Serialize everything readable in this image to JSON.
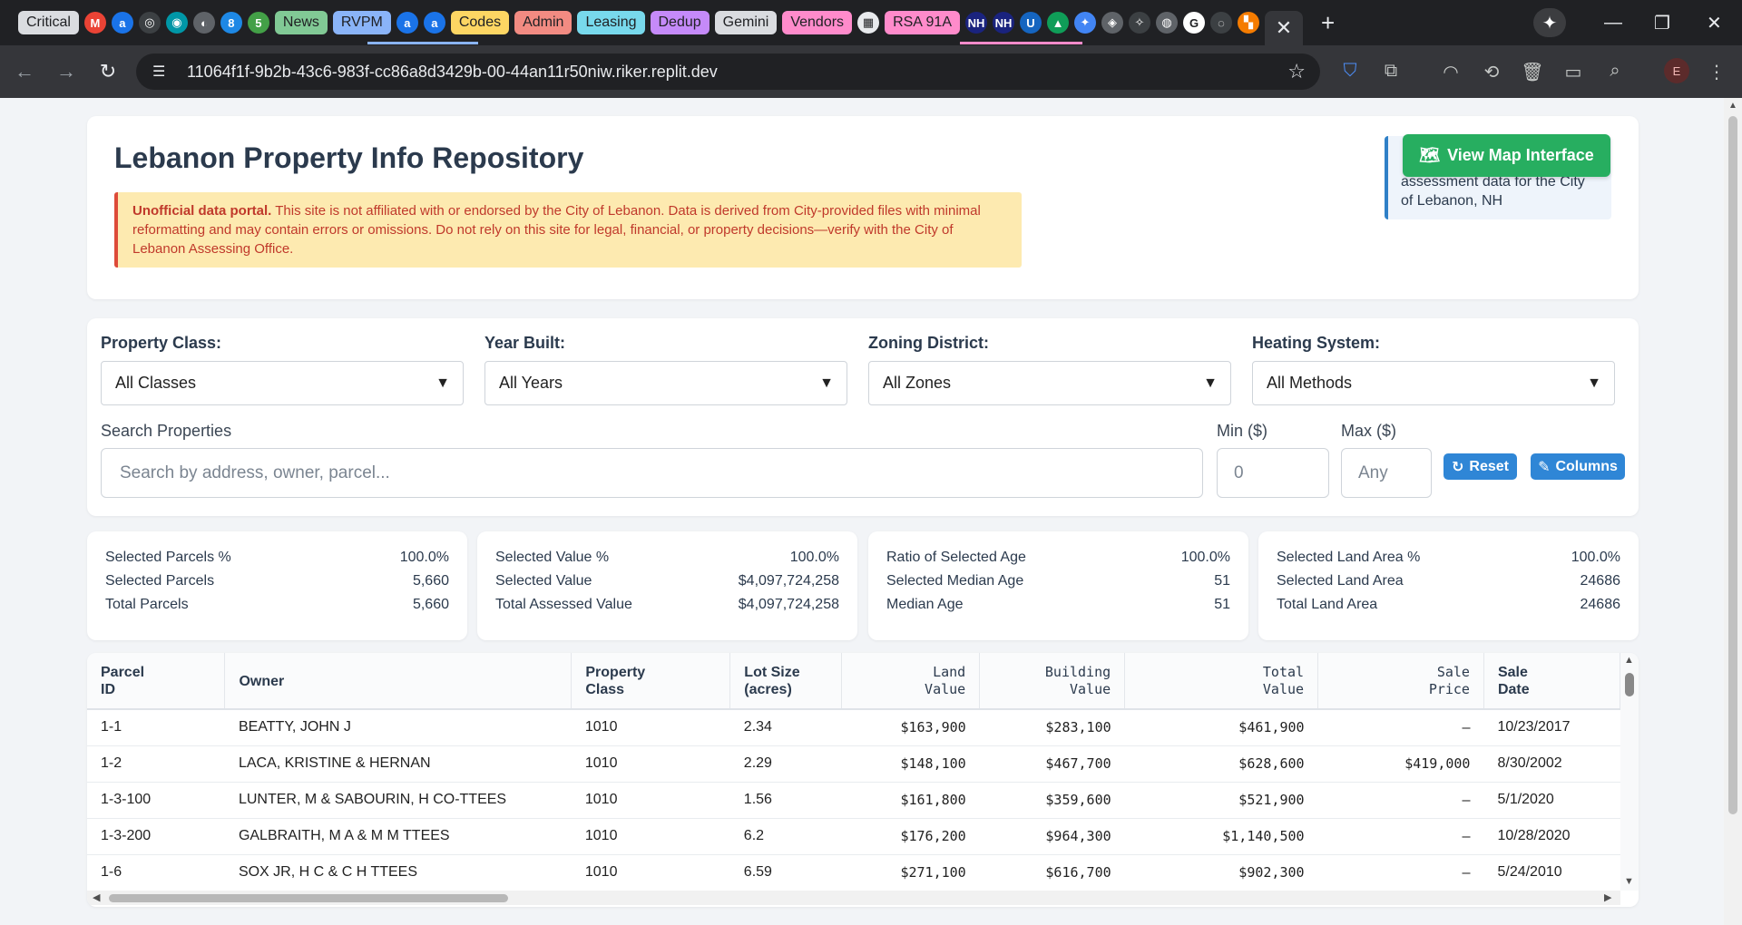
{
  "browser": {
    "tabs": [
      {
        "label": "Critical",
        "kind": "pill",
        "bg": "#dadce0",
        "fg": "#202124"
      },
      {
        "label": "M",
        "kind": "icon",
        "bg": "#ea4335"
      },
      {
        "label": "a",
        "kind": "icon",
        "bg": "#1a73e8"
      },
      {
        "label": "◎",
        "kind": "icon",
        "bg": "#3c4043"
      },
      {
        "label": "◉",
        "kind": "icon",
        "bg": "#0097a7"
      },
      {
        "label": "◐",
        "kind": "icon",
        "bg": "#5f6368"
      },
      {
        "label": "8",
        "kind": "icon",
        "bg": "#1e88e5"
      },
      {
        "label": "5",
        "kind": "icon",
        "bg": "#43a047"
      },
      {
        "label": "News",
        "kind": "pill",
        "bg": "#81c995",
        "fg": "#202124"
      },
      {
        "label": "RVPM",
        "kind": "pill",
        "bg": "#8ab4f8",
        "fg": "#202124"
      },
      {
        "label": "a",
        "kind": "icon",
        "bg": "#1a73e8"
      },
      {
        "label": "a",
        "kind": "icon",
        "bg": "#1a73e8"
      },
      {
        "label": "Codes",
        "kind": "pill",
        "bg": "#fdd663",
        "fg": "#202124"
      },
      {
        "label": "Admin",
        "kind": "pill",
        "bg": "#f28b82",
        "fg": "#202124"
      },
      {
        "label": "Leasing",
        "kind": "pill",
        "bg": "#78d9ec",
        "fg": "#202124"
      },
      {
        "label": "Dedup",
        "kind": "pill",
        "bg": "#c58af9",
        "fg": "#202124"
      },
      {
        "label": "Gemini",
        "kind": "pill",
        "bg": "#dadce0",
        "fg": "#202124"
      },
      {
        "label": "Vendors",
        "kind": "pill",
        "bg": "#ff8bcb",
        "fg": "#202124"
      },
      {
        "label": "▦",
        "kind": "icon",
        "bg": "#e8eaed"
      },
      {
        "label": "RSA 91A",
        "kind": "pill",
        "bg": "#ff8bcb",
        "fg": "#202124"
      },
      {
        "label": "NH",
        "kind": "icon",
        "bg": "#1a237e"
      },
      {
        "label": "NH",
        "kind": "icon",
        "bg": "#1a237e"
      },
      {
        "label": "U",
        "kind": "icon",
        "bg": "#1565c0"
      },
      {
        "label": "▲",
        "kind": "icon",
        "bg": "#0f9d58"
      },
      {
        "label": "✦",
        "kind": "icon",
        "bg": "#4285f4"
      },
      {
        "label": "◈",
        "kind": "icon",
        "bg": "#5f6368"
      },
      {
        "label": "✧",
        "kind": "icon",
        "bg": "#3c4043"
      },
      {
        "label": "◍",
        "kind": "icon",
        "bg": "#5f6368"
      },
      {
        "label": "G",
        "kind": "icon",
        "bg": "#fff"
      },
      {
        "label": "◌",
        "kind": "icon",
        "bg": "#3c4043"
      },
      {
        "label": "▚",
        "kind": "icon",
        "bg": "#f57c00"
      }
    ],
    "active_tab_close": "✕",
    "new_tab": "+",
    "url": "11064f1f-9b2b-43c6-983f-cc86a8d3429b-00-44an11r50niw.riker.replit.dev",
    "profile_initial": "E"
  },
  "header": {
    "title": "Lebanon Property Info Repository",
    "disclaimer_strong": "Unofficial data portal.",
    "disclaimer_text": " This site is not affiliated with or endorsed by the City of Lebanon. Data is derived from City-provided files with minimal reformatting and may contain errors or omissions. Do not rely on this site for legal, financial, or property decisions—verify with the City of Lebanon Assessing Office.",
    "info_text": "assessment data for the City of Lebanon, NH",
    "map_button": "View Map Interface",
    "map_icon": "🗺"
  },
  "filters": {
    "property_class_label": "Property Class:",
    "property_class_value": "All Classes",
    "year_built_label": "Year Built:",
    "year_built_value": "All Years",
    "zoning_label": "Zoning District:",
    "zoning_value": "All Zones",
    "heating_label": "Heating System:",
    "heating_value": "All Methods",
    "caret": "▼",
    "search_label": "Search Properties",
    "search_placeholder": "Search by address, owner, parcel...",
    "min_label": "Min ($)",
    "min_value": "0",
    "max_label": "Max ($)",
    "max_placeholder": "Any",
    "reset_label": "Reset",
    "reset_icon": "↻",
    "columns_label": "Columns",
    "columns_icon": "✎"
  },
  "stats": [
    {
      "rows": [
        [
          "Selected Parcels %",
          "100.0%"
        ],
        [
          "Selected Parcels",
          "5,660"
        ],
        [
          "Total Parcels",
          "5,660"
        ]
      ]
    },
    {
      "rows": [
        [
          "Selected Value %",
          "100.0%"
        ],
        [
          "Selected Value",
          "$4,097,724,258"
        ],
        [
          "Total Assessed Value",
          "$4,097,724,258"
        ]
      ]
    },
    {
      "rows": [
        [
          "Ratio of Selected Age",
          "100.0%"
        ],
        [
          "Selected Median Age",
          "51"
        ],
        [
          "Median Age",
          "51"
        ]
      ]
    },
    {
      "rows": [
        [
          "Selected Land Area %",
          "100.0%"
        ],
        [
          "Selected Land Area",
          "24686"
        ],
        [
          "Total Land Area",
          "24686"
        ]
      ]
    }
  ],
  "table": {
    "columns": [
      {
        "l1": "Parcel",
        "l2": "ID",
        "num": false
      },
      {
        "l1": "Owner",
        "l2": "",
        "num": false
      },
      {
        "l1": "Property",
        "l2": "Class",
        "num": false
      },
      {
        "l1": "Lot Size",
        "l2": "(acres)",
        "num": false
      },
      {
        "l1": "Land",
        "l2": "Value",
        "num": true
      },
      {
        "l1": "Building",
        "l2": "Value",
        "num": true
      },
      {
        "l1": "Total",
        "l2": "Value",
        "num": true
      },
      {
        "l1": "Sale",
        "l2": "Price",
        "num": true
      },
      {
        "l1": "Sale",
        "l2": "Date",
        "num": false
      }
    ],
    "rows": [
      [
        "1-1",
        "BEATTY, JOHN J",
        "1010",
        "2.34",
        "$163,900",
        "$283,100",
        "$461,900",
        "—",
        "10/23/2017"
      ],
      [
        "1-2",
        "LACA, KRISTINE & HERNAN",
        "1010",
        "2.29",
        "$148,100",
        "$467,700",
        "$628,600",
        "$419,000",
        "8/30/2002"
      ],
      [
        "1-3-100",
        "LUNTER, M & SABOURIN, H CO-TTEES",
        "1010",
        "1.56",
        "$161,800",
        "$359,600",
        "$521,900",
        "—",
        "5/1/2020"
      ],
      [
        "1-3-200",
        "GALBRAITH, M A & M M TTEES",
        "1010",
        "6.2",
        "$176,200",
        "$964,300",
        "$1,140,500",
        "—",
        "10/28/2020"
      ],
      [
        "1-6",
        "SOX JR, H C & C H TTEES",
        "1010",
        "6.59",
        "$271,100",
        "$616,700",
        "$902,300",
        "—",
        "5/24/2010"
      ]
    ]
  }
}
